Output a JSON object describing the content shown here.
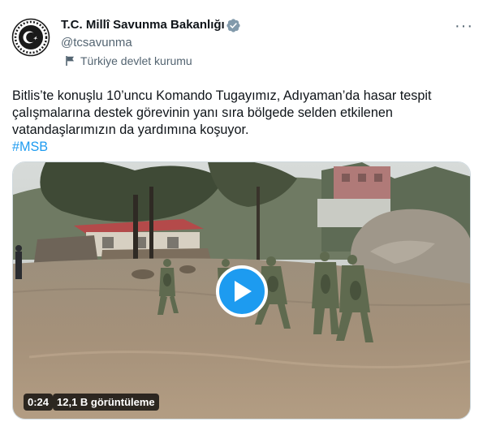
{
  "account": {
    "name": "T.C. Millî Savunma Bakanlığı",
    "handle": "@tcsavunma",
    "affiliation": "Türkiye devlet kurumu",
    "verified": true,
    "verified_color": "#829aab",
    "avatar_icon": "crescent-star-emblem"
  },
  "tweet": {
    "text_line1": "Bitlis’te konuşlu 10’uncu Komando Tugayımız, Adıyaman’da hasar tespit",
    "text_line2": "çalışmalarına destek görevinin yanı sıra bölgede selden etkilenen",
    "text_line3": "vatandaşlarımızın da yardımına koşuyor.",
    "hashtag": "#MSB"
  },
  "video": {
    "duration": "0:24",
    "views": "12,1 B görüntüleme",
    "play_icon": "play-icon"
  },
  "colors": {
    "accent": "#1d9bf0",
    "text": "#0f1419",
    "muted": "#536471"
  }
}
